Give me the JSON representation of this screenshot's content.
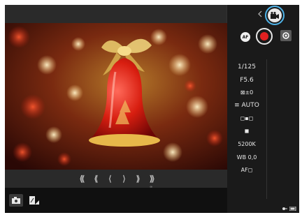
{
  "colors": {
    "accent": "#4fb3e8",
    "record": "#e02020",
    "panel": "#1a1a1a"
  },
  "sidebar": {
    "movie_mode_icon": "movie-camera-icon",
    "af_label": "AF",
    "settings": [
      {
        "name": "shutter-speed",
        "value": "1/125"
      },
      {
        "name": "aperture",
        "value": "F5.6"
      },
      {
        "name": "exposure-compensation",
        "value": "⊠±0"
      },
      {
        "name": "iso",
        "value": "≡ AUTO"
      },
      {
        "name": "metering-mode",
        "value": "◻▪◻"
      },
      {
        "name": "picture-style",
        "value": "◼"
      },
      {
        "name": "white-balance",
        "value": "5200K"
      },
      {
        "name": "wb-shift",
        "value": "WB 0,0"
      },
      {
        "name": "af-method",
        "value": "AF◻"
      }
    ]
  },
  "navigation": {
    "buttons": [
      {
        "name": "nav-first-button",
        "label": "⟨⟨⟨"
      },
      {
        "name": "nav-fast-back-button",
        "label": "⟨⟨"
      },
      {
        "name": "nav-back-button",
        "label": "⟨"
      },
      {
        "name": "nav-forward-button",
        "label": "⟩"
      },
      {
        "name": "nav-fast-forward-button",
        "label": "⟩⟩"
      },
      {
        "name": "nav-last-button",
        "label": "⟩⟩⟩",
        "sub": "∞"
      }
    ]
  },
  "bottom": {
    "modes": [
      {
        "name": "still-camera-icon",
        "active": true
      },
      {
        "name": "exposure-mode-icon",
        "active": false
      }
    ],
    "footer_icons": [
      "key-icon",
      "battery-icon"
    ]
  }
}
